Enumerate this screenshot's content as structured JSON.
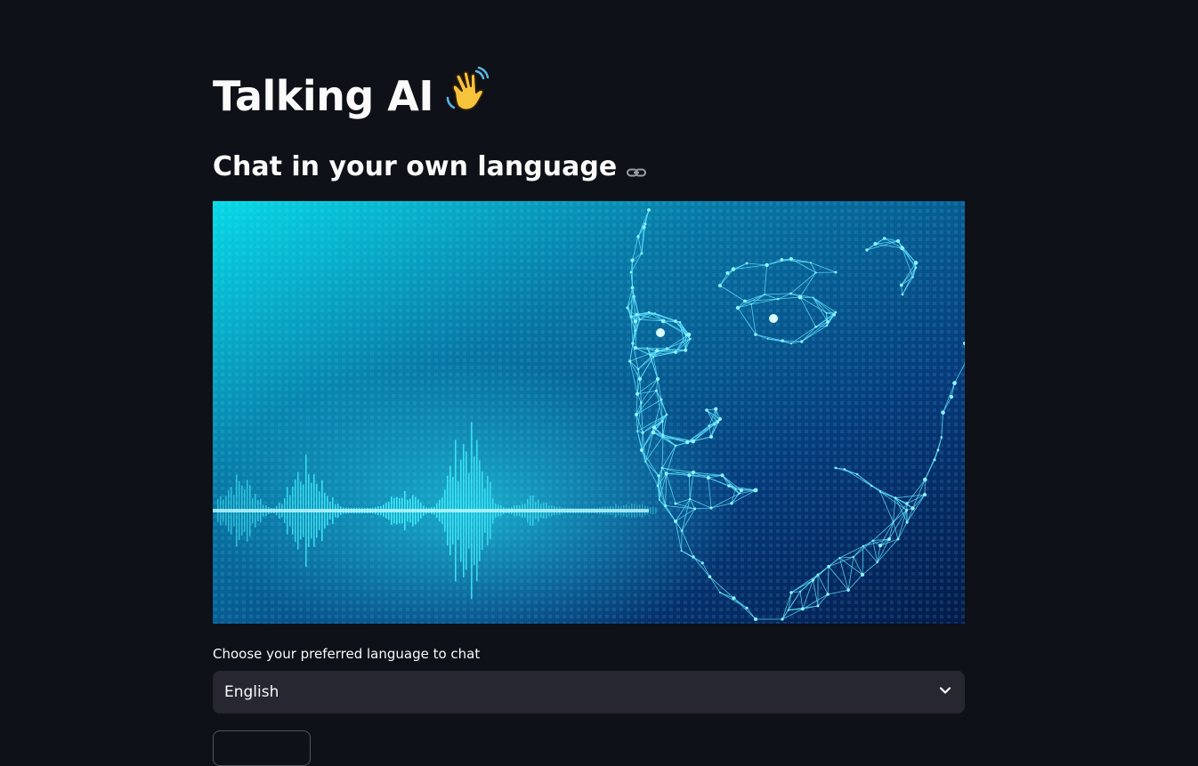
{
  "app": {
    "title": "Talking AI",
    "title_emoji": "👋",
    "subheader": "Chat in your own language"
  },
  "hero_image": {
    "description_icon": "ai-face-soundwave-image"
  },
  "language_select": {
    "label": "Choose your preferred language to chat",
    "selected": "English"
  },
  "colors": {
    "background": "#0e1117",
    "text": "#fafafa",
    "select_bg": "#262730",
    "accent_cyan": "#19e3f0"
  }
}
